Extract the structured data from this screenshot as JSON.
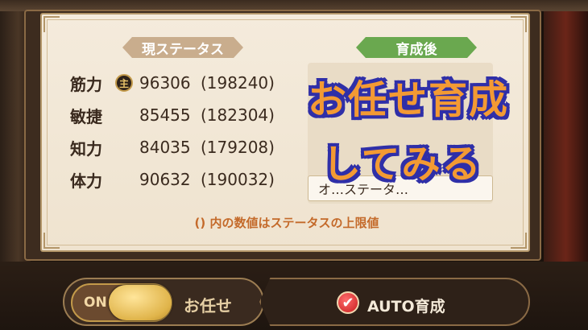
{
  "headers": {
    "current": "現ステータス",
    "after": "育成後"
  },
  "stats": [
    {
      "name": "筋力",
      "badge": "主",
      "value": "96306",
      "max": "(198240)"
    },
    {
      "name": "敏捷",
      "badge": "",
      "value": "85455",
      "max": "(182304)"
    },
    {
      "name": "知力",
      "badge": "",
      "value": "84035",
      "max": "(179208)"
    },
    {
      "name": "体力",
      "badge": "",
      "value": "90632",
      "max": "(190032)"
    }
  ],
  "after_box_text": "オ…ステータ…",
  "note": "() 内の数値はステータスの上限値",
  "overlay": {
    "line1": "お任せ育成",
    "line2": "してみる"
  },
  "controls": {
    "toggle_state": "ON",
    "toggle_label": "お任せ",
    "auto_label": "AUTO育成",
    "auto_checked": true
  },
  "colors": {
    "note_color": "#c46a2a",
    "after_header": "#6aa84f",
    "overlay_fill": "#f39a33",
    "overlay_outline": "#2f2fa8"
  }
}
